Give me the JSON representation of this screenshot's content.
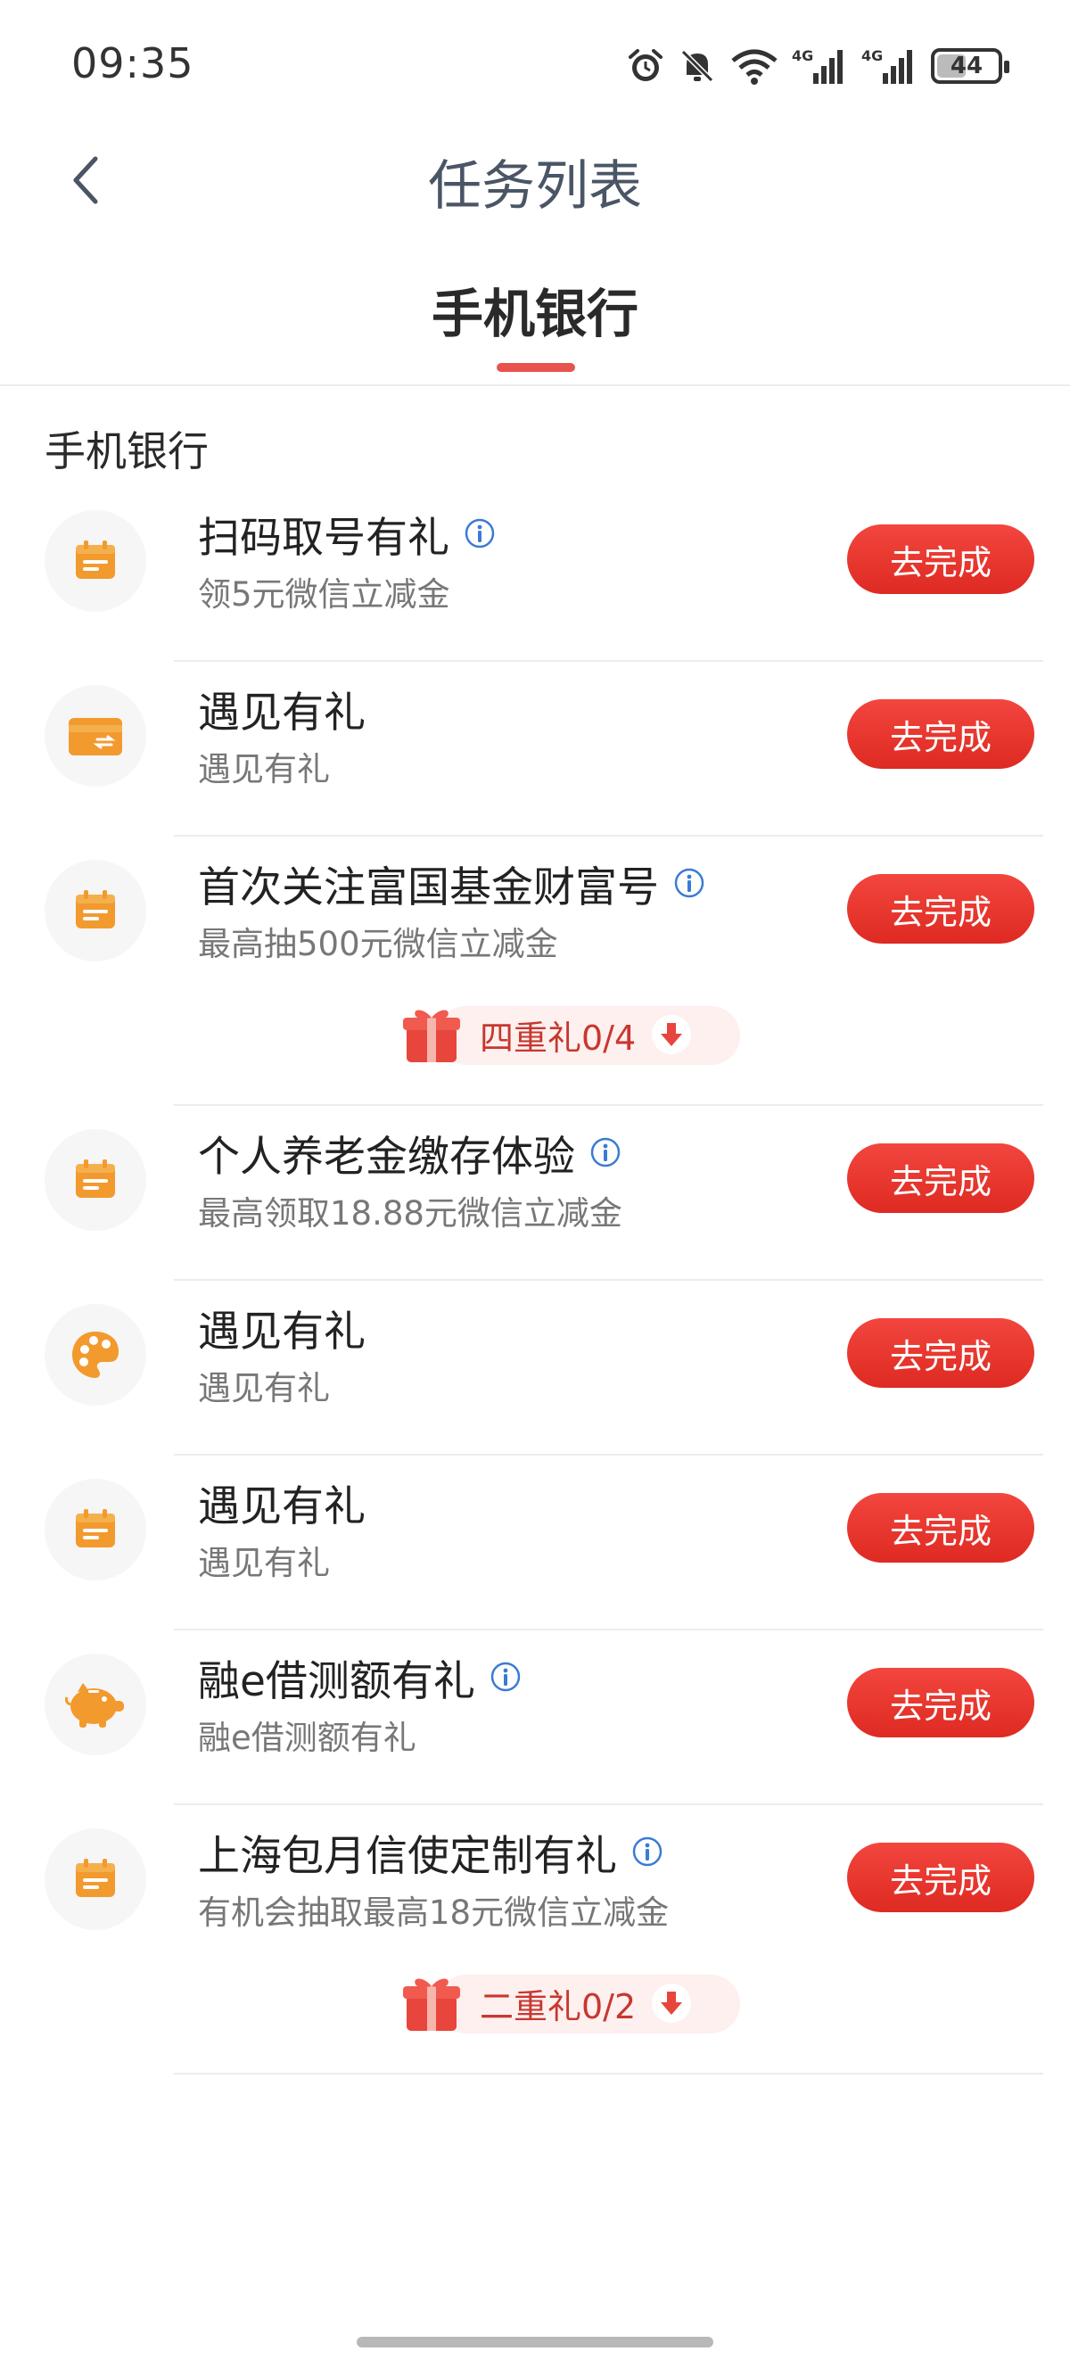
{
  "status_bar": {
    "time": "09:35",
    "icons": [
      "alarm-icon",
      "mute-icon",
      "wifi-icon",
      "signal-4g-icon",
      "signal-4g-icon"
    ],
    "network_1": "4G",
    "network_2": "4G",
    "battery": "44"
  },
  "nav": {
    "back_icon": "chevron-left-icon",
    "title": "任务列表"
  },
  "tabs": [
    {
      "label": "手机银行",
      "active": true
    }
  ],
  "accent_color": "#e8534e",
  "button_color": "#e7332b",
  "icon_color": "#f29a2e",
  "section": {
    "title": "手机银行"
  },
  "tasks": [
    {
      "icon": "calendar-icon",
      "title": "扫码取号有礼",
      "has_info": true,
      "subtitle": "领5元微信立减金",
      "button": "去完成"
    },
    {
      "icon": "card-icon",
      "title": "遇见有礼",
      "has_info": false,
      "subtitle": "遇见有礼",
      "button": "去完成"
    },
    {
      "icon": "calendar-icon",
      "title": "首次关注富国基金财富号",
      "has_info": true,
      "subtitle": "最高抽500元微信立减金",
      "button": "去完成",
      "gift": "四重礼0/4"
    },
    {
      "icon": "calendar-icon",
      "title": "个人养老金缴存体验",
      "has_info": true,
      "subtitle": "最高领取18.88元微信立减金",
      "button": "去完成"
    },
    {
      "icon": "palette-icon",
      "title": "遇见有礼",
      "has_info": false,
      "subtitle": "遇见有礼",
      "button": "去完成"
    },
    {
      "icon": "calendar-icon",
      "title": "遇见有礼",
      "has_info": false,
      "subtitle": "遇见有礼",
      "button": "去完成"
    },
    {
      "icon": "piggy-bank-icon",
      "title": "融e借测额有礼",
      "has_info": true,
      "subtitle": "融e借测额有礼",
      "button": "去完成"
    },
    {
      "icon": "calendar-icon",
      "title": "上海包月信使定制有礼",
      "has_info": true,
      "subtitle": "有机会抽取最高18元微信立减金",
      "button": "去完成",
      "gift": "二重礼0/2"
    }
  ]
}
